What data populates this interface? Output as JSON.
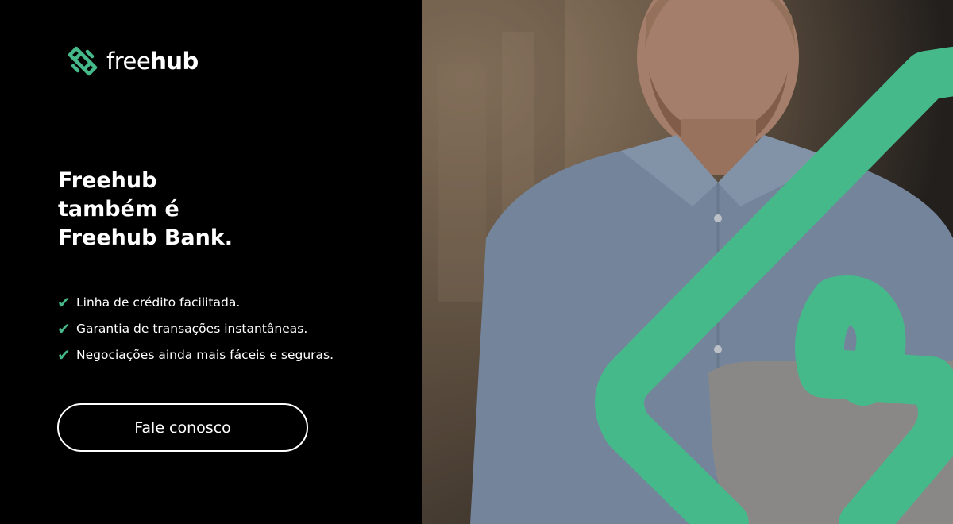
{
  "brand": {
    "name_regular": "free",
    "name_bold": "hub",
    "accent_color": "#46b98a"
  },
  "headline": {
    "line1": "Freehub",
    "line2": "também é",
    "line3": "Freehub Bank."
  },
  "features": [
    {
      "icon": "checkmark-icon",
      "text": "Linha de crédito facilitada."
    },
    {
      "icon": "checkmark-icon",
      "text": "Garantia de transações instantâneas."
    },
    {
      "icon": "checkmark-icon",
      "text": "Negociações ainda mais fáceis e seguras."
    }
  ],
  "cta": {
    "label": "Fale conosco"
  },
  "photo": {
    "subject": "man-with-laptop-photo"
  }
}
